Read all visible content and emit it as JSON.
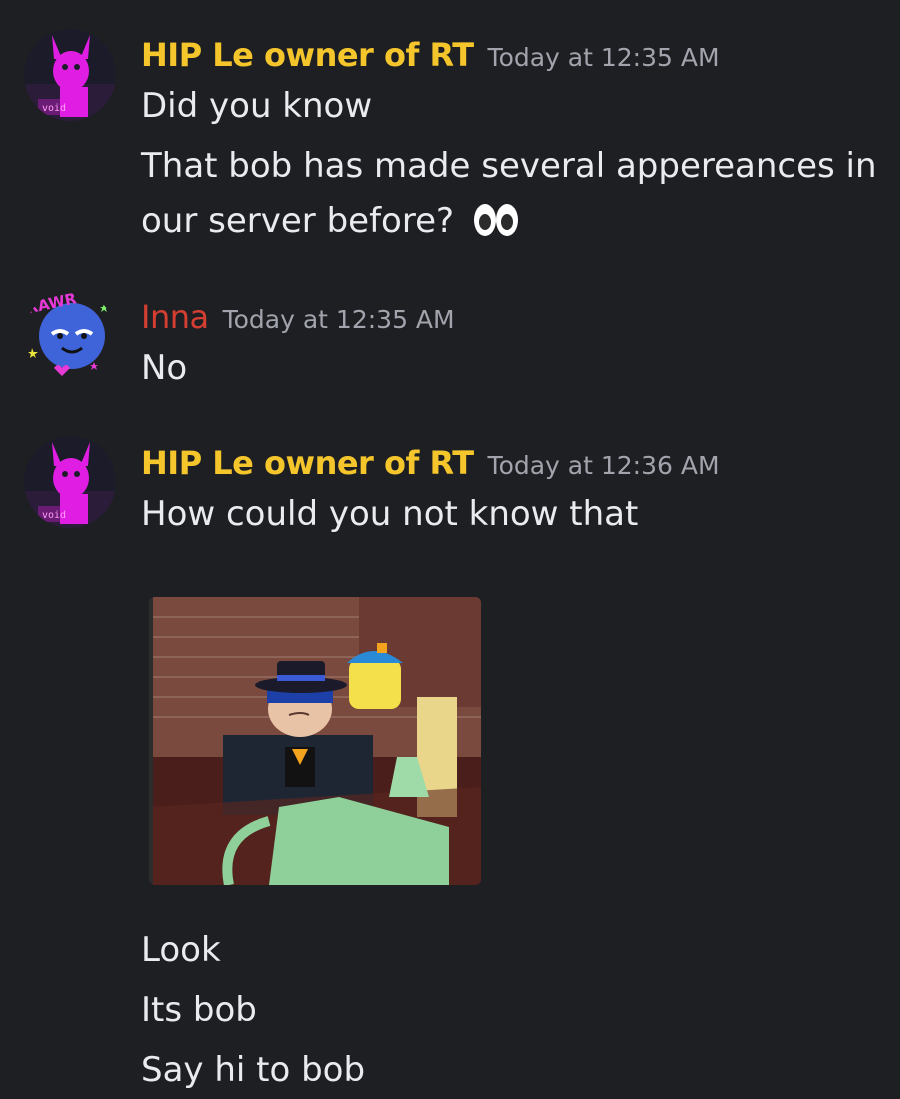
{
  "colors": {
    "background": "#1e1f22",
    "hip_name": "#f5c52c",
    "inna_name": "#d43f32",
    "timestamp": "#a1a4ad",
    "message_text": "#eaebee"
  },
  "messages": [
    {
      "author": "HIP Le owner of RT",
      "timestamp": "Today at 12:35 AM",
      "avatar_icon": "pink-bunny-void-avatar",
      "avatar_text": "void",
      "lines": [
        "Did you know",
        "That bob has made several appereances in",
        "our server before?"
      ],
      "emoji": "eyes-emoji"
    },
    {
      "author": "Inna",
      "timestamp": "Today at 12:35 AM",
      "avatar_icon": "blue-face-rawr-sticker-avatar",
      "avatar_text": "RAWR",
      "lines": [
        "No"
      ]
    },
    {
      "author": "HIP Le owner of RT",
      "timestamp": "Today at 12:36 AM",
      "avatar_icon": "pink-bunny-void-avatar",
      "avatar_text": "void",
      "lines": [
        "How could you not know that",
        "Look",
        "Its bob",
        "Say hi to bob"
      ],
      "attachment": "roblox-bob-screenshot"
    }
  ]
}
